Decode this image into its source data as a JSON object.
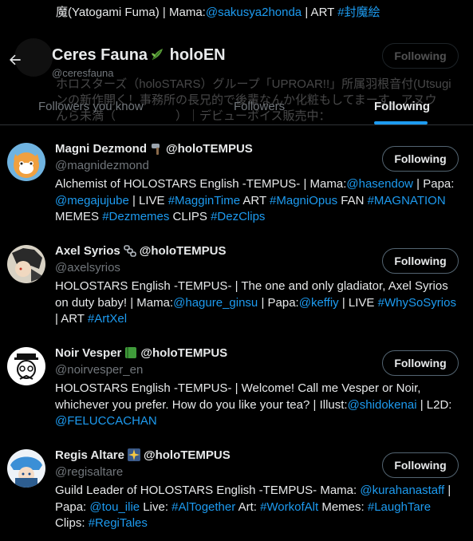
{
  "background_top": {
    "line1_start": "魔(Yatogami Fuma) | Mama:",
    "line1_mama": "@sakusya2honda",
    "line1_art": " | ART ",
    "line1_tag": "#封魔絵",
    "line2": "ホロスターズ（holoSTARS）グループ「UPROAR!!」所属羽根音付(Utsugi",
    "line3": "ンの新作開く！事務所の長兄的で後輩なんか化粧もしてまーす、アヌウ",
    "line4": "んら未満（　　　　　）｜デビューボイス販売中："
  },
  "header": {
    "back_icon": "arrow-left-icon",
    "title": "Ceres Fauna",
    "title_suffix": " holoEN",
    "handle": "@ceresfauna"
  },
  "tabs": [
    {
      "label": "Followers you know",
      "active": false
    },
    {
      "label": "Followers",
      "active": false
    },
    {
      "label": "Following",
      "active": true
    }
  ],
  "users": [
    {
      "name": "Magni Dezmond",
      "name_suffix": " @holoTEMPUS",
      "emoji": "hammer-icon",
      "handle": "@magnidezmond",
      "button": "Following",
      "bio": [
        {
          "t": "Alchemist of HOLOSTARS English -TEMPUS- | Mama:"
        },
        {
          "t": "@hasendow",
          "link": true
        },
        {
          "t": " | Papa: "
        },
        {
          "t": "@megajujube",
          "link": true
        },
        {
          "t": " | LIVE "
        },
        {
          "t": "#MagginTime",
          "link": true
        },
        {
          "t": " ART "
        },
        {
          "t": "#MagniOpus",
          "link": true
        },
        {
          "t": " FAN "
        },
        {
          "t": "#MAGNATION",
          "link": true
        },
        {
          "t": " MEMES "
        },
        {
          "t": "#Dezmemes",
          "link": true
        },
        {
          "t": " CLIPS "
        },
        {
          "t": "#DezClips",
          "link": true
        }
      ]
    },
    {
      "name": "Axel Syrios",
      "name_suffix": " @holoTEMPUS",
      "emoji": "chains-icon",
      "handle": "@axelsyrios",
      "button": "Following",
      "bio": [
        {
          "t": "HOLOSTARS English -TEMPUS- | The one and only gladiator, Axel Syrios on duty baby! | Mama:"
        },
        {
          "t": "@hagure_ginsu",
          "link": true
        },
        {
          "t": " | Papa:"
        },
        {
          "t": "@keffiy",
          "link": true
        },
        {
          "t": " | LIVE "
        },
        {
          "t": "#WhySoSyrios",
          "link": true
        },
        {
          "t": " | ART "
        },
        {
          "t": "#ArtXel",
          "link": true
        }
      ]
    },
    {
      "name": "Noir Vesper",
      "name_suffix": " @holoTEMPUS",
      "emoji": "green-book-icon",
      "handle": "@noirvesper_en",
      "button": "Following",
      "bio": [
        {
          "t": "HOLOSTARS English -TEMPUS- | Welcome! Call me Vesper or Noir, whichever you prefer. How do you like your tea? | Illust:"
        },
        {
          "t": "@shidokenai",
          "link": true
        },
        {
          "t": " | L2D: "
        },
        {
          "t": "@FELUCCACHAN",
          "link": true
        }
      ]
    },
    {
      "name": "Regis Altare",
      "name_suffix": " @holoTEMPUS",
      "emoji": "sparkle-star-icon",
      "handle": "@regisaltare",
      "button": "Following",
      "bio": [
        {
          "t": "Guild Leader of HOLOSTARS English -TEMPUS- Mama: "
        },
        {
          "t": "@kurahanastaff",
          "link": true
        },
        {
          "t": " | Papa: "
        },
        {
          "t": "@tou_ilie",
          "link": true
        },
        {
          "t": " Live: "
        },
        {
          "t": "#AlTogether",
          "link": true
        },
        {
          "t": " Art: "
        },
        {
          "t": "#WorkofAlt",
          "link": true
        },
        {
          "t": " Memes: "
        },
        {
          "t": "#LaughTare",
          "link": true
        },
        {
          "t": " Clips: "
        },
        {
          "t": "#RegiTales",
          "link": true
        }
      ]
    }
  ],
  "colors": {
    "background": "#000000",
    "text": "#e7e9ea",
    "muted": "#71767b",
    "accent": "#1d9bf0",
    "border": "#2f3336"
  }
}
